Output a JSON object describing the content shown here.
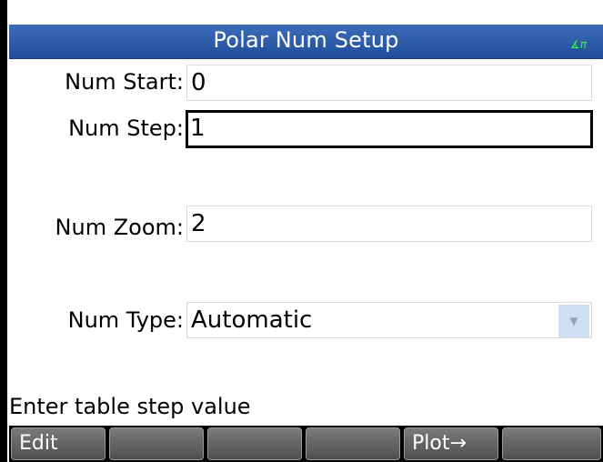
{
  "title": "Polar Num Setup",
  "angle_indicator": "∡π",
  "fields": {
    "num_start": {
      "label": "Num Start:",
      "value": "0"
    },
    "num_step": {
      "label": "Num Step:",
      "value": "1"
    },
    "num_zoom": {
      "label": "Num Zoom:",
      "value": "2"
    },
    "num_type": {
      "label": "Num Type:",
      "value": "Automatic"
    }
  },
  "dropdown_arrow_glyph": "▼",
  "status": "Enter table step value",
  "softkeys": [
    "Edit",
    "",
    "",
    "",
    "Plot→",
    ""
  ],
  "colors": {
    "titlebar": "#1f4d9c",
    "angle_indicator": "#33ff33",
    "dropdown": "#cfe0f4"
  }
}
